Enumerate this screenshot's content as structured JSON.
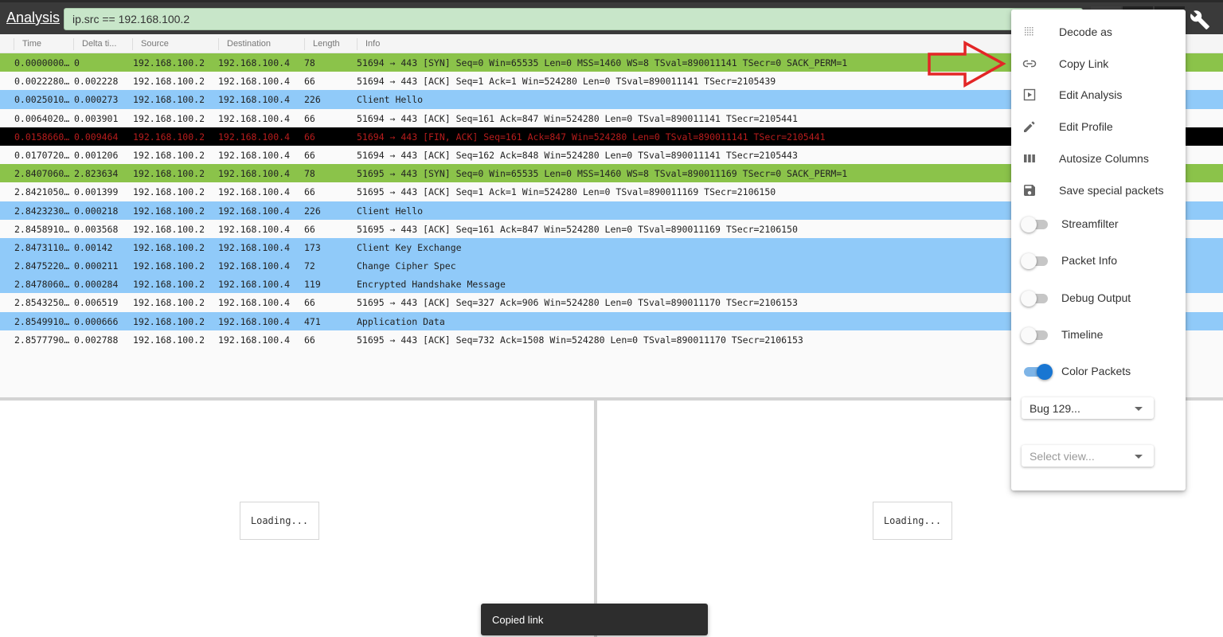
{
  "toolbar": {
    "brand": "Analysis",
    "filter_value": "ip.src == 192.168.100.2",
    "buttons": [
      "toolbar-button",
      "toolbar-button",
      "toolbar-button"
    ],
    "settings_icon": "wrench-icon"
  },
  "table": {
    "columns": [
      "Time",
      "Delta ti...",
      "Source",
      "Destination",
      "Length",
      "Info"
    ],
    "rows": [
      {
        "time": "0.0000000…",
        "delta": "0",
        "source": "192.168.100.2",
        "destination": "192.168.100.4",
        "length": "78",
        "info": "51694 → 443 [SYN] Seq=0 Win=65535 Len=0 MSS=1460 WS=8 TSval=890011141 TSecr=0 SACK_PERM=1",
        "color": "green"
      },
      {
        "time": "0.0022280…",
        "delta": "0.002228",
        "source": "192.168.100.2",
        "destination": "192.168.100.4",
        "length": "66",
        "info": "51694 → 443 [ACK] Seq=1 Ack=1 Win=524280 Len=0 TSval=890011141 TSecr=2105439",
        "color": "white"
      },
      {
        "time": "0.0025010…",
        "delta": "0.000273",
        "source": "192.168.100.2",
        "destination": "192.168.100.4",
        "length": "226",
        "info": "Client Hello",
        "color": "blue"
      },
      {
        "time": "0.0064020…",
        "delta": "0.003901",
        "source": "192.168.100.2",
        "destination": "192.168.100.4",
        "length": "66",
        "info": "51694 → 443 [ACK] Seq=161 Ack=847 Win=524280 Len=0 TSval=890011141 TSecr=2105441",
        "color": "white"
      },
      {
        "time": "0.0158660…",
        "delta": "0.009464",
        "source": "192.168.100.2",
        "destination": "192.168.100.4",
        "length": "66",
        "info": "51694 → 443 [FIN, ACK] Seq=161 Ack=847 Win=524280 Len=0 TSval=890011141 TSecr=2105441",
        "color": "black"
      },
      {
        "time": "0.0170720…",
        "delta": "0.001206",
        "source": "192.168.100.2",
        "destination": "192.168.100.4",
        "length": "66",
        "info": "51694 → 443 [ACK] Seq=162 Ack=848 Win=524280 Len=0 TSval=890011141 TSecr=2105443",
        "color": "white"
      },
      {
        "time": "2.8407060…",
        "delta": "2.823634",
        "source": "192.168.100.2",
        "destination": "192.168.100.4",
        "length": "78",
        "info": "51695 → 443 [SYN] Seq=0 Win=65535 Len=0 MSS=1460 WS=8 TSval=890011169 TSecr=0 SACK_PERM=1",
        "color": "green"
      },
      {
        "time": "2.8421050…",
        "delta": "0.001399",
        "source": "192.168.100.2",
        "destination": "192.168.100.4",
        "length": "66",
        "info": "51695 → 443 [ACK] Seq=1 Ack=1 Win=524280 Len=0 TSval=890011169 TSecr=2106150",
        "color": "white"
      },
      {
        "time": "2.8423230…",
        "delta": "0.000218",
        "source": "192.168.100.2",
        "destination": "192.168.100.4",
        "length": "226",
        "info": "Client Hello",
        "color": "blue"
      },
      {
        "time": "2.8458910…",
        "delta": "0.003568",
        "source": "192.168.100.2",
        "destination": "192.168.100.4",
        "length": "66",
        "info": "51695 → 443 [ACK] Seq=161 Ack=847 Win=524280 Len=0 TSval=890011169 TSecr=2106150",
        "color": "white"
      },
      {
        "time": "2.8473110…",
        "delta": "0.00142",
        "source": "192.168.100.2",
        "destination": "192.168.100.4",
        "length": "173",
        "info": "Client Key Exchange",
        "color": "blue"
      },
      {
        "time": "2.8475220…",
        "delta": "0.000211",
        "source": "192.168.100.2",
        "destination": "192.168.100.4",
        "length": "72",
        "info": "Change Cipher Spec",
        "color": "blue"
      },
      {
        "time": "2.8478060…",
        "delta": "0.000284",
        "source": "192.168.100.2",
        "destination": "192.168.100.4",
        "length": "119",
        "info": "Encrypted Handshake Message",
        "color": "blue"
      },
      {
        "time": "2.8543250…",
        "delta": "0.006519",
        "source": "192.168.100.2",
        "destination": "192.168.100.4",
        "length": "66",
        "info": "51695 → 443 [ACK] Seq=327 Ack=906 Win=524280 Len=0 TSval=890011170 TSecr=2106153",
        "color": "white"
      },
      {
        "time": "2.8549910…",
        "delta": "0.000666",
        "source": "192.168.100.2",
        "destination": "192.168.100.4",
        "length": "471",
        "info": "Application Data",
        "color": "blue"
      },
      {
        "time": "2.8577790…",
        "delta": "0.002788",
        "source": "192.168.100.2",
        "destination": "192.168.100.4",
        "length": "66",
        "info": "51695 → 443 [ACK] Seq=732 Ack=1508 Win=524280 Len=0 TSval=890011170 TSecr=2106153",
        "color": "white"
      }
    ]
  },
  "panes": {
    "left_loading": "Loading...",
    "right_loading": "Loading..."
  },
  "menu": {
    "items": [
      {
        "label": "Decode as",
        "icon": "grid-dots-icon"
      },
      {
        "label": "Copy Link",
        "icon": "link-icon"
      },
      {
        "label": "Edit Analysis",
        "icon": "play-box-icon"
      },
      {
        "label": "Edit Profile",
        "icon": "pencil-icon"
      },
      {
        "label": "Autosize Columns",
        "icon": "columns-icon"
      },
      {
        "label": "Save special packets",
        "icon": "save-icon"
      }
    ],
    "toggles": [
      {
        "label": "Streamfilter",
        "on": false
      },
      {
        "label": "Packet Info",
        "on": false
      },
      {
        "label": "Debug Output",
        "on": false
      },
      {
        "label": "Timeline",
        "on": false
      },
      {
        "label": "Color Packets",
        "on": true
      }
    ],
    "profile_select": "Bug 129...",
    "view_select_placeholder": "Select view..."
  },
  "snackbar": {
    "message": "Copied link"
  },
  "colors": {
    "toolbar_bg": "#3a3a3a",
    "filter_bg": "#c8e6c9",
    "row_green": "#8bc34a",
    "row_blue": "#90caf9",
    "row_black": "#000000",
    "row_black_text": "#b71c1c",
    "toggle_on": "#1976d2",
    "annotation_arrow": "#e32626"
  }
}
